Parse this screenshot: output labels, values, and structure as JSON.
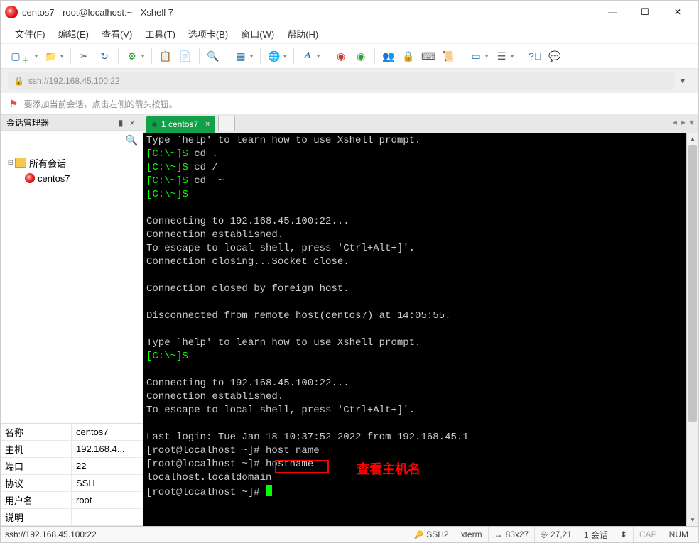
{
  "window": {
    "title": "centos7 - root@localhost:~ - Xshell 7"
  },
  "menu": {
    "file": "文件(F)",
    "edit": "编辑(E)",
    "view": "查看(V)",
    "tools": "工具(T)",
    "tabs": "选项卡(B)",
    "window": "窗口(W)",
    "help": "帮助(H)"
  },
  "address": {
    "url": "ssh://192.168.45.100:22"
  },
  "hint": {
    "text": "要添加当前会话，点击左侧的箭头按钮。"
  },
  "sidebar": {
    "title": "会话管理器",
    "root_label": "所有会话",
    "session_label": "centos7"
  },
  "props": {
    "name_k": "名称",
    "name_v": "centos7",
    "host_k": "主机",
    "host_v": "192.168.4...",
    "port_k": "端口",
    "port_v": "22",
    "proto_k": "协议",
    "proto_v": "SSH",
    "user_k": "用户名",
    "user_v": "root",
    "desc_k": "说明",
    "desc_v": ""
  },
  "tab": {
    "label": "1  centos7"
  },
  "terminal": {
    "lines": [
      {
        "type": "text",
        "text": "Type `help' to learn how to use Xshell prompt."
      },
      {
        "type": "prompt",
        "prompt": "[C:\\~]$ ",
        "cmd": "cd ."
      },
      {
        "type": "prompt",
        "prompt": "[C:\\~]$ ",
        "cmd": "cd /"
      },
      {
        "type": "prompt",
        "prompt": "[C:\\~]$ ",
        "cmd": "cd  ~"
      },
      {
        "type": "prompt",
        "prompt": "[C:\\~]$ ",
        "cmd": ""
      },
      {
        "type": "blank"
      },
      {
        "type": "text",
        "text": "Connecting to 192.168.45.100:22..."
      },
      {
        "type": "text",
        "text": "Connection established."
      },
      {
        "type": "text",
        "text": "To escape to local shell, press 'Ctrl+Alt+]'."
      },
      {
        "type": "text",
        "text": "Connection closing...Socket close."
      },
      {
        "type": "blank"
      },
      {
        "type": "text",
        "text": "Connection closed by foreign host."
      },
      {
        "type": "blank"
      },
      {
        "type": "text",
        "text": "Disconnected from remote host(centos7) at 14:05:55."
      },
      {
        "type": "blank"
      },
      {
        "type": "text",
        "text": "Type `help' to learn how to use Xshell prompt."
      },
      {
        "type": "prompt",
        "prompt": "[C:\\~]$ ",
        "cmd": ""
      },
      {
        "type": "blank"
      },
      {
        "type": "text",
        "text": "Connecting to 192.168.45.100:22..."
      },
      {
        "type": "text",
        "text": "Connection established."
      },
      {
        "type": "text",
        "text": "To escape to local shell, press 'Ctrl+Alt+]'."
      },
      {
        "type": "blank"
      },
      {
        "type": "text",
        "text": "Last login: Tue Jan 18 10:37:52 2022 from 192.168.45.1"
      },
      {
        "type": "text",
        "text": "[root@localhost ~]# host name"
      },
      {
        "type": "text",
        "text": "[root@localhost ~]# hostname"
      },
      {
        "type": "text",
        "text": "localhost.localdomain"
      },
      {
        "type": "cursor",
        "text": "[root@localhost ~]# "
      }
    ]
  },
  "annotation": {
    "text": "查看主机名"
  },
  "status": {
    "left": "ssh://192.168.45.100:22",
    "ssh": "SSH2",
    "term": "xterm",
    "size": "83x27",
    "pos": "27,21",
    "sessions": "1  会话",
    "cap": "CAP",
    "num": "NUM"
  }
}
